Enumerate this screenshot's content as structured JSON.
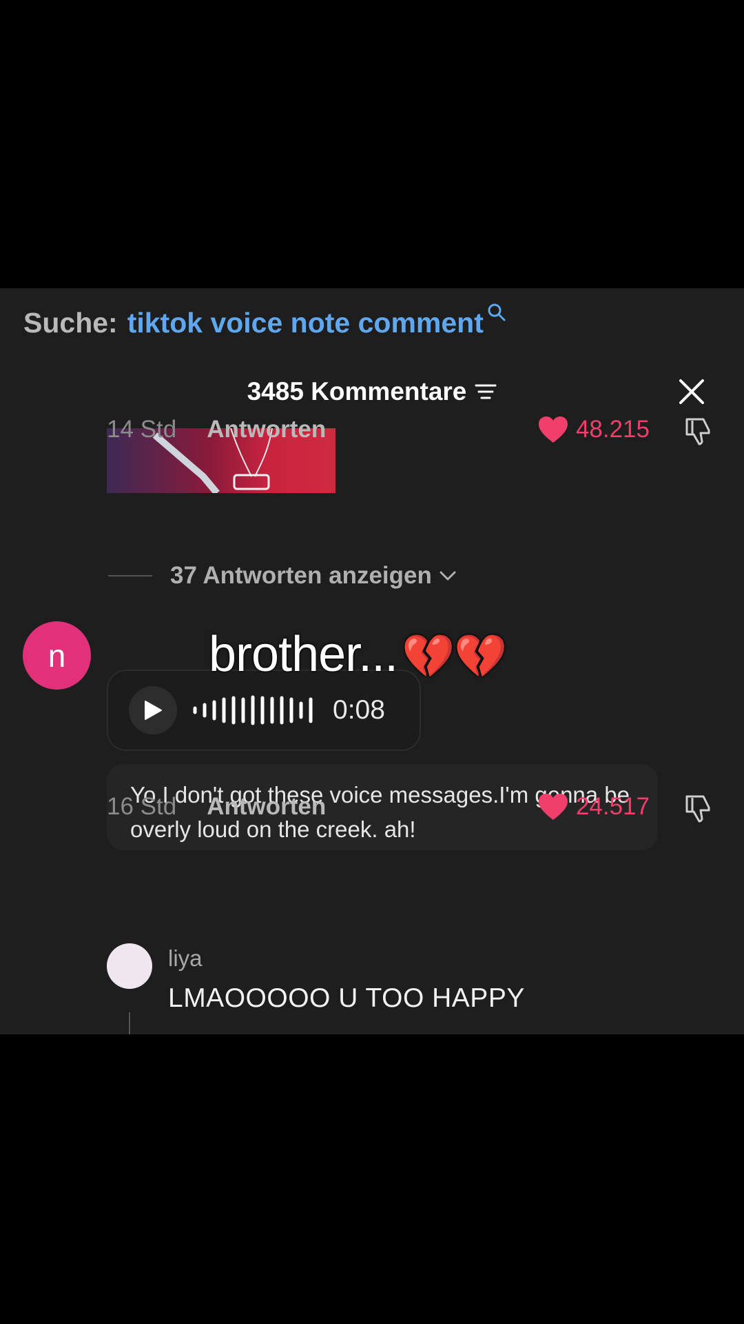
{
  "search": {
    "prefix": "Suche:",
    "query": "tiktok voice note comment"
  },
  "header": {
    "count_title": "3485 Kommentare"
  },
  "comment1": {
    "time": "14 Std",
    "reply_label": "Antworten",
    "likes": "48.215",
    "replies_toggle": "37 Antworten anzeigen"
  },
  "overlay": {
    "caption": "brother...",
    "emoji": "💔💔"
  },
  "comment2": {
    "avatar_letter": "n",
    "voice_duration": "0:08",
    "transcript": "Yo,I don't got these voice messages.I'm gonna be overly loud on the creek. ah!",
    "time": "16 Std",
    "reply_label": "Antworten",
    "likes": "24.517"
  },
  "reply": {
    "username": "liya",
    "text": "LMAOOOOO U TOO HAPPY"
  },
  "colors": {
    "accent_like": "#f23e6a",
    "search_query": "#5fa8f0",
    "avatar_n": "#e2317a"
  },
  "icons": [
    "search-icon",
    "filter-icon",
    "close-icon",
    "heart-icon",
    "dislike-icon",
    "chevron-down-icon",
    "play-icon",
    "waveform-icon"
  ]
}
